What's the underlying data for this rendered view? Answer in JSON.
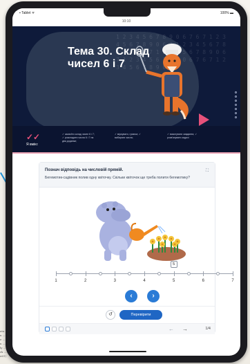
{
  "statusbar": {
    "left": "▪ Tablet ᯤ",
    "right": "100% ▬"
  },
  "url": "10:10",
  "hero": {
    "title": "Тема 30. Склад чисел 6 і 7",
    "logo_text": "Я вмію:",
    "columns": [
      "✓ засвоїти склад чисел 6 і 7;\n✓ розкладати числа 6 і 7 на два доданки;",
      "✓ міркувати, граючи; ✓ вибирати числа;",
      "✓ виконувати завдання;\n✓ розв'язувати задачі"
    ],
    "number_pattern": "1 2 3 4 5 6 7 8 9 0 6 7 6 7 1 2 3 4 5 6 7 8 9 0 6 7 1 2 3 4 5 6 7 8 9 0 6 7 6 7 1 2 3 4 5 6 7 8 9 0 6 7 1 2 3 4 5 6 7 8 9 0 6 7 6 7 1 2 3 4 5 6 7 8 9 0"
  },
  "exercise": {
    "title": "Познач відповідь на числовій прямій.",
    "subtitle": "Бегемотик-садівник полив одну квіточку. Скільки квіточок ще треба полити бегемотику?",
    "selected_value": "5",
    "check_label": "Перевірити",
    "reset_icon": "↺",
    "prev_icon": "‹",
    "next_icon": "›",
    "page_count": "1/4"
  },
  "numberline": {
    "labels": [
      "1",
      "2",
      "3",
      "4",
      "5",
      "6",
      "7"
    ],
    "selected": 5
  },
  "colors": {
    "accent": "#2a7bd6",
    "hero_bg": "#0e1a3a",
    "play": "#e6517a"
  },
  "icons": [
    "reset-icon",
    "prev-icon",
    "next-icon",
    "expand-icon",
    "arrow-left-icon",
    "arrow-right-icon",
    "play-icon"
  ]
}
